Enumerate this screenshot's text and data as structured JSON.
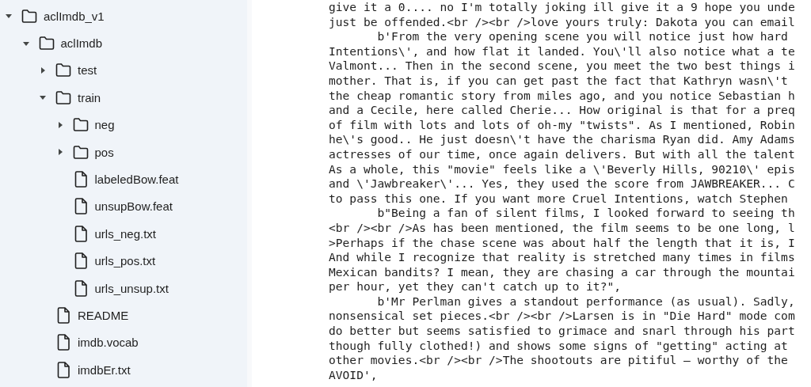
{
  "file_tree": [
    {
      "name": "aclImdb_v1",
      "kind": "folder",
      "expanded": true,
      "children": [
        {
          "name": "aclImdb",
          "kind": "folder",
          "expanded": true,
          "children": [
            {
              "name": "test",
              "kind": "folder",
              "expanded": false
            },
            {
              "name": "train",
              "kind": "folder",
              "expanded": true,
              "children": [
                {
                  "name": "neg",
                  "kind": "folder",
                  "expanded": false
                },
                {
                  "name": "pos",
                  "kind": "folder",
                  "expanded": false
                },
                {
                  "name": "labeledBow.feat",
                  "kind": "file"
                },
                {
                  "name": "unsupBow.feat",
                  "kind": "file"
                },
                {
                  "name": "urls_neg.txt",
                  "kind": "file"
                },
                {
                  "name": "urls_pos.txt",
                  "kind": "file"
                },
                {
                  "name": "urls_unsup.txt",
                  "kind": "file"
                }
              ]
            },
            {
              "name": "README",
              "kind": "file"
            },
            {
              "name": "imdb.vocab",
              "kind": "file"
            },
            {
              "name": "imdbEr.txt",
              "kind": "file"
            }
          ]
        }
      ]
    }
  ],
  "output_lines": [
    {
      "text": "give it a 0.... no I'm totally joking ill give it a 9 hope you unde",
      "indented": false
    },
    {
      "text": "just be offended.<br /><br />love yours truly: Dakota you can email",
      "indented": false
    },
    {
      "text": "b'From the very opening scene you will notice just how hard",
      "indented": true
    },
    {
      "text": "Intentions\\', and how flat it landed. You\\'ll also notice what a te",
      "indented": false
    },
    {
      "text": "Valmont... Then in the second scene, you meet the two best things i",
      "indented": false
    },
    {
      "text": "mother. That is, if you can get past the fact that Kathryn wasn\\'t",
      "indented": false
    },
    {
      "text": "the cheap romantic story from miles ago, and you notice Sebastian h",
      "indented": false
    },
    {
      "text": "and a Cecile, here called Cherie... How original is that for a preq",
      "indented": false
    },
    {
      "text": "of film with lots and lots of oh-my \"twists\". As I mentioned, Robin",
      "indented": false
    },
    {
      "text": "he\\'s good.. He just doesn\\'t have the charisma Ryan did. Amy Adams",
      "indented": false
    },
    {
      "text": "actresses of our time, once again delivers. But with all the talent",
      "indented": false
    },
    {
      "text": "As a whole, this \"movie\" feels like a \\'Beverly Hills, 90210\\' epis",
      "indented": false
    },
    {
      "text": "and \\'Jawbreaker\\'... Yes, they used the score from JAWBREAKER... C",
      "indented": false
    },
    {
      "text": "to pass this one. If you want more Cruel Intentions, watch Stephen",
      "indented": false
    },
    {
      "text": "b\"Being a fan of silent films, I looked forward to seeing th",
      "indented": true
    },
    {
      "text": "<br /><br />As has been mentioned, the film seems to be one long, l",
      "indented": false
    },
    {
      "text": ">Perhaps if the chase scene was about half the length that it is, I",
      "indented": false
    },
    {
      "text": "And while I recognize that reality is stretched many times in films",
      "indented": false
    },
    {
      "text": "Mexican bandits? I mean, they are chasing a car through the mountai",
      "indented": false
    },
    {
      "text": "per hour, yet they can't catch up to it?\",",
      "indented": false
    },
    {
      "text": "b'Mr Perlman gives a standout performance (as usual). Sadly,",
      "indented": true
    },
    {
      "text": "nonsensical set pieces.<br /><br />Larsen is in \"Die Hard\" mode com",
      "indented": false
    },
    {
      "text": "do better but seems satisfied to grimace and snarl through his part",
      "indented": false
    },
    {
      "text": "though fully clothed!) and shows some signs of \"getting\" acting at",
      "indented": false
    },
    {
      "text": "other movies.<br /><br />The shootouts are pitiful – worthy of the",
      "indented": false
    },
    {
      "text": "AVOID',",
      "indented": false
    }
  ]
}
